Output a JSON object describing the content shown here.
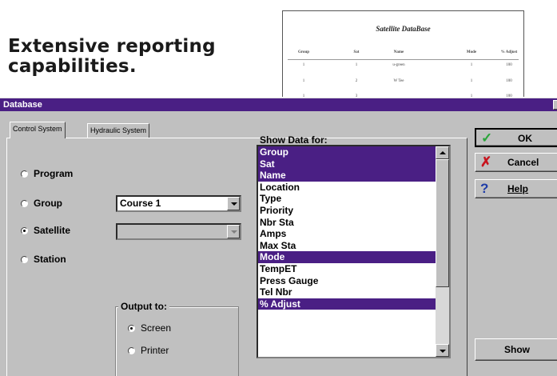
{
  "headline": {
    "line1": "Extensive reporting",
    "line2": "capabilities."
  },
  "report": {
    "title": "Satellite DataBase",
    "columns": [
      "Group",
      "Sat",
      "Name",
      "Mode",
      "% Adjust"
    ],
    "rows": [
      [
        "1",
        "1",
        "u-green",
        "1",
        "100"
      ],
      [
        "1",
        "2",
        "W Tee",
        "1",
        "100"
      ],
      [
        "1",
        "3",
        "",
        "1",
        "100"
      ]
    ]
  },
  "window": {
    "title": "Database",
    "accent": "#4a1f84"
  },
  "tabs": [
    {
      "label": "Control System",
      "active": true
    },
    {
      "label": "Hydraulic System",
      "active": false
    }
  ],
  "options": [
    {
      "label": "Program",
      "checked": false
    },
    {
      "label": "Group",
      "checked": false
    },
    {
      "label": "Satellite",
      "checked": true
    },
    {
      "label": "Station",
      "checked": false
    }
  ],
  "group_combo": {
    "value": "Course 1"
  },
  "satellite_combo": {
    "value": ""
  },
  "output": {
    "label": "Output to:",
    "options": [
      {
        "label": "Screen",
        "checked": true
      },
      {
        "label": "Printer",
        "checked": false
      }
    ]
  },
  "show_data": {
    "label": "Show Data for:",
    "items": [
      {
        "label": "Group",
        "selected": true
      },
      {
        "label": "Sat",
        "selected": true
      },
      {
        "label": "Name",
        "selected": true
      },
      {
        "label": "Location",
        "selected": false
      },
      {
        "label": "Type",
        "selected": false
      },
      {
        "label": "Priority",
        "selected": false
      },
      {
        "label": "Nbr Sta",
        "selected": false
      },
      {
        "label": "Amps",
        "selected": false
      },
      {
        "label": "Max Sta",
        "selected": false
      },
      {
        "label": "Mode",
        "selected": true
      },
      {
        "label": "TempET",
        "selected": false
      },
      {
        "label": "Press Gauge",
        "selected": false
      },
      {
        "label": "Tel Nbr",
        "selected": false
      },
      {
        "label": "% Adjust",
        "selected": true
      }
    ]
  },
  "buttons": {
    "ok": "OK",
    "cancel": "Cancel",
    "help": "Help",
    "show": "Show"
  },
  "icons": {
    "ok": "checkmark-icon",
    "cancel": "x-icon",
    "help": "question-mark-icon"
  },
  "colors": {
    "ok_icon": "#2aa53a",
    "cancel_icon": "#c8141e",
    "help_icon": "#1e3ca8"
  }
}
